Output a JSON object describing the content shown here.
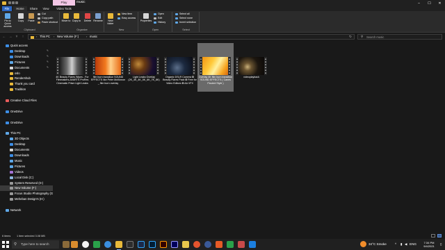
{
  "window": {
    "title": "music",
    "ribbon_context_tab": "Play",
    "minimize": "–",
    "maximize": "☐",
    "close": "✕"
  },
  "tabs": [
    "File",
    "Home",
    "Share",
    "View",
    "Video Tools"
  ],
  "ribbon": {
    "clipboard": {
      "label": "Clipboard",
      "pin": "Pin to Quick access",
      "copy": "Copy",
      "paste": "Paste",
      "cut": "Cut",
      "copy_path": "Copy path",
      "paste_shortcut": "Paste shortcut"
    },
    "organize": {
      "label": "Organize",
      "move_to": "Move to",
      "copy_to": "Copy to",
      "delete": "Delete",
      "rename": "Rename"
    },
    "new": {
      "label": "New",
      "new_folder": "New folder",
      "new_item": "New item",
      "easy_access": "Easy access"
    },
    "open": {
      "label": "Open",
      "properties": "Properties",
      "open": "Open",
      "edit": "Edit",
      "history": "History"
    },
    "select": {
      "label": "Select",
      "select_all": "Select all",
      "select_none": "Select none",
      "invert_selection": "Invert selection"
    }
  },
  "address": {
    "back": "←",
    "forward": "→",
    "recent": "˅",
    "up": "↑",
    "crumbs": [
      "This PC",
      "New Volume (F:)",
      "music"
    ],
    "refresh": "↻",
    "search_placeholder": "Search music"
  },
  "nav": {
    "items": [
      {
        "label": "Quick access",
        "icon": "star-icon",
        "color": "#3d8ee6",
        "indent": 1
      },
      {
        "label": "Desktop",
        "icon": "desktop-icon",
        "color": "#3d8ee6",
        "indent": 2,
        "pinned": true
      },
      {
        "label": "Downloads",
        "icon": "download-icon",
        "color": "#3d8ee6",
        "indent": 2,
        "pinned": true
      },
      {
        "label": "Pictures",
        "icon": "pictures-icon",
        "color": "#5fa8e8",
        "indent": 2,
        "pinned": true
      },
      {
        "label": "Documents",
        "icon": "documents-icon",
        "color": "#d6d6d6",
        "indent": 2,
        "pinned": true
      },
      {
        "label": "oslo",
        "icon": "folder-icon",
        "color": "#e8b93a",
        "indent": 2
      },
      {
        "label": "Rendershub",
        "icon": "folder-icon",
        "color": "#e8b93a",
        "indent": 2
      },
      {
        "label": "Thank you card",
        "icon": "folder-icon",
        "color": "#e8b93a",
        "indent": 2
      },
      {
        "label": "Tradition",
        "icon": "folder-icon",
        "color": "#e8b93a",
        "indent": 2
      },
      {
        "label": "",
        "icon": "",
        "color": "",
        "indent": 0
      },
      {
        "label": "Creative Cloud Files",
        "icon": "creative-cloud-icon",
        "color": "#e85c5c",
        "indent": 1
      },
      {
        "label": "",
        "icon": "",
        "color": "",
        "indent": 0
      },
      {
        "label": "OneDrive",
        "icon": "cloud-icon",
        "color": "#3d8ee6",
        "indent": 1
      },
      {
        "label": "",
        "icon": "",
        "color": "",
        "indent": 0
      },
      {
        "label": "OneDrive",
        "icon": "cloud-icon",
        "color": "#3d8ee6",
        "indent": 1
      },
      {
        "label": "",
        "icon": "",
        "color": "",
        "indent": 0
      },
      {
        "label": "This PC",
        "icon": "computer-icon",
        "color": "#5fa8e8",
        "indent": 1
      },
      {
        "label": "3D Objects",
        "icon": "cube-icon",
        "color": "#5fa8e8",
        "indent": 2
      },
      {
        "label": "Desktop",
        "icon": "desktop-icon",
        "color": "#3d8ee6",
        "indent": 2
      },
      {
        "label": "Documents",
        "icon": "documents-icon",
        "color": "#d6d6d6",
        "indent": 2
      },
      {
        "label": "Downloads",
        "icon": "download-icon",
        "color": "#3d8ee6",
        "indent": 2
      },
      {
        "label": "Music",
        "icon": "music-icon",
        "color": "#5fa8e8",
        "indent": 2
      },
      {
        "label": "Pictures",
        "icon": "pictures-icon",
        "color": "#5fa8e8",
        "indent": 2
      },
      {
        "label": "Videos",
        "icon": "video-icon",
        "color": "#a472d6",
        "indent": 2
      },
      {
        "label": "Local Disk (C:)",
        "icon": "drive-icon",
        "color": "#8fb8e0",
        "indent": 2
      },
      {
        "label": "System Reserved (D:)",
        "icon": "drive-icon",
        "color": "#9a9a9a",
        "indent": 2
      },
      {
        "label": "New Volume (F:)",
        "icon": "drive-icon",
        "color": "#9a9a9a",
        "indent": 2,
        "selected": true
      },
      {
        "label": "Focus Studio Photography (G:)",
        "icon": "drive-icon",
        "color": "#9a9a9a",
        "indent": 2
      },
      {
        "label": "Meheban Design's (H:)",
        "icon": "drive-icon",
        "color": "#9a9a9a",
        "indent": 2
      },
      {
        "label": "",
        "icon": "",
        "color": "",
        "indent": 0
      },
      {
        "label": "Network",
        "icon": "network-icon",
        "color": "#5fa8e8",
        "indent": 1
      }
    ]
  },
  "files": [
    {
      "name": "4K Beauty Flares Wipes - For Filmmakers-AVARTS ProRes Cinematic Prism Light Leaks",
      "thumb": "prism"
    },
    {
      "name": "film burn transition SOUND EFFECTS like Peter McKinnon _ film burn overlay",
      "thumb": "orange"
    },
    {
      "name": "Light Leaks Overlay (2K_3K_4K_5K_6K_7K_8K)",
      "thumb": "leak"
    },
    {
      "name": "Organic DSLR Camera ✪ Beauty Flares Pack ✪ Free for Video Editors ✪ AA VFX",
      "thumb": "dark"
    },
    {
      "name": "Overlay 4K film burn transition SOUND EFFECTS ( Canes Flouted Style )",
      "thumb": "yellow",
      "selected": true
    },
    {
      "name": "videoplayback",
      "thumb": "bokeh"
    }
  ],
  "status": {
    "items": "6 items",
    "selected": "1 item selected  3.08 MB"
  },
  "taskbar": {
    "search_placeholder": "Type here to search",
    "weather": "34°C  Smoke",
    "tray_caret": "^",
    "language": "ENG",
    "time": "7:34 PM",
    "date": "9/4/2021"
  }
}
